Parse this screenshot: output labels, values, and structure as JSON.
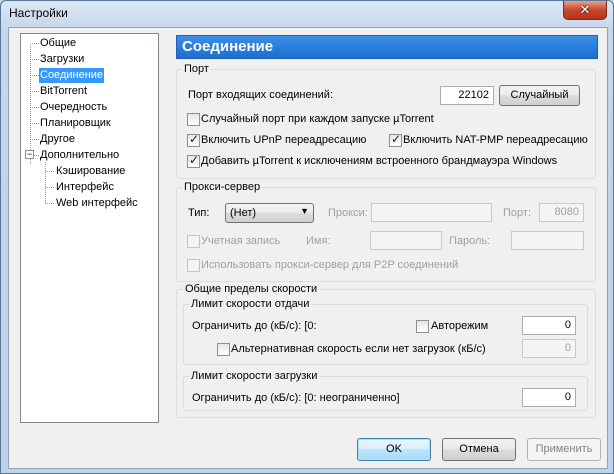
{
  "window": {
    "title": "Настройки",
    "close_glyph": "✕"
  },
  "tree": {
    "items": [
      "Общие",
      "Загрузки",
      "Соединение",
      "BitTorrent",
      "Очередность",
      "Планировщик",
      "Другое",
      "Дополнительно"
    ],
    "subitems": [
      "Кэширование",
      "Интерфейс",
      "Web интерфейс"
    ],
    "expander": "−"
  },
  "header": {
    "title": "Соединение"
  },
  "port": {
    "group_label": "Порт",
    "incoming_label": "Порт входящих соединений:",
    "incoming_value": "22102",
    "random_button": "Случайный",
    "random_each_start": "Случайный порт при каждом запуске µTorrent",
    "upnp": "Включить UPnP переадресацию",
    "natpmp": "Включить NAT-PMP переадресацию",
    "firewall": "Добавить µTorrent к исключениям встроенного брандмауэра Windows",
    "check_glyph": "✓"
  },
  "proxy": {
    "group_label": "Прокси-сервер",
    "type_label": "Тип:",
    "type_value": "(Нет)",
    "arrow": "▼",
    "proxy_label": "Прокси:",
    "port_label": "Порт:",
    "port_value": "8080",
    "auth_label": "Учетная запись",
    "name_label": "Имя:",
    "password_label": "Пароль:",
    "p2p_label": "Использовать прокси-сервер для P2P соединений"
  },
  "speed": {
    "group_label": "Общие пределы скорости",
    "upload_group": "Лимит скорости отдачи",
    "upload_limit_label": "Ограничить до (кБ/с): [0:",
    "auto_label": "Авторежим",
    "upload_value": "0",
    "alt_label": "Альтернативная скорость если нет загрузок (кБ/с)",
    "alt_value": "0",
    "download_group": "Лимит скорости загрузки",
    "download_limit_label": "Ограничить до (кБ/с): [0: неограниченно]",
    "download_value": "0"
  },
  "buttons": {
    "ok": "OK",
    "cancel": "Отмена",
    "apply": "Применить"
  }
}
